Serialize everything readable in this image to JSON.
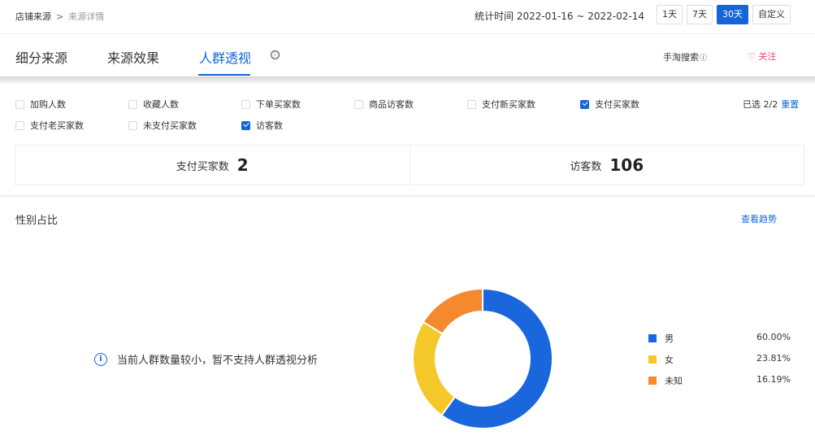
{
  "breadcrumb": {
    "root": "店铺来源",
    "sep": ">",
    "current": "来源详情"
  },
  "stat_time": "统计时间 2022-01-16 ~ 2022-02-14",
  "range_buttons": [
    "1天",
    "7天",
    "30天",
    "自定义"
  ],
  "active_range": "30天",
  "tabs": [
    "细分来源",
    "来源效果",
    "人群透视"
  ],
  "active_tab": "人群透视",
  "tab_info_icon": "ⓘ",
  "toolbar": {
    "search": "手淘搜索",
    "follow": "关注"
  },
  "filters": {
    "items": [
      {
        "label": "加购人数",
        "checked": false
      },
      {
        "label": "收藏人数",
        "checked": false
      },
      {
        "label": "下单买家数",
        "checked": false
      },
      {
        "label": "商品访客数",
        "checked": false
      },
      {
        "label": "支付新买家数",
        "checked": false
      },
      {
        "label": "支付买家数",
        "checked": true
      },
      {
        "label": "支付老买家数",
        "checked": false
      },
      {
        "label": "未支付买家数",
        "checked": false
      },
      {
        "label": "访客数",
        "checked": true
      }
    ],
    "selected_text": "已选 2/2",
    "reset_label": "重置"
  },
  "metrics": [
    {
      "label": "支付买家数",
      "value": "2"
    },
    {
      "label": "访客数",
      "value": "106"
    }
  ],
  "section": {
    "title": "性别占比",
    "trend_link": "查看趋势"
  },
  "notice": "当前人群数量较小，暂不支持人群透视分析",
  "colors": {
    "accent": "#1565d8",
    "male": "#1a66dc",
    "female": "#f5c829",
    "unknown": "#f5892e",
    "follow": "#e84a6b"
  },
  "chart_data": {
    "type": "pie",
    "categories": [
      "男",
      "女",
      "未知"
    ],
    "values": [
      60.0,
      23.81,
      16.19
    ],
    "labels": [
      "60.00%",
      "23.81%",
      "16.19%"
    ]
  }
}
